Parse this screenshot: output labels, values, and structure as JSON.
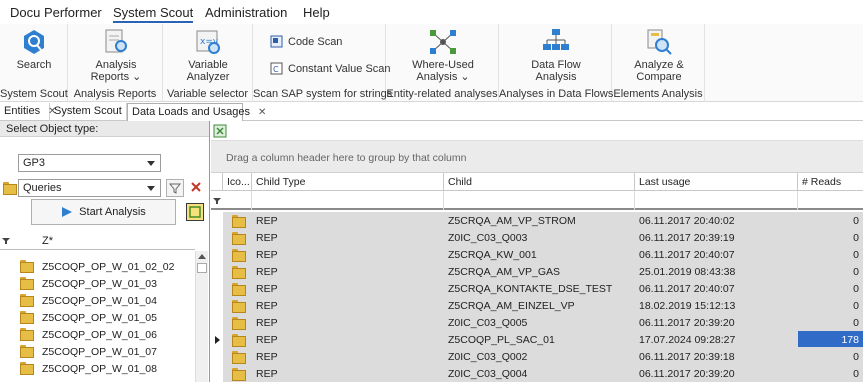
{
  "menu": {
    "items": [
      "Docu Performer",
      "System Scout",
      "Administration",
      "Help"
    ],
    "active": "System Scout"
  },
  "ribbon": {
    "search": "Search",
    "analysis_reports_l1": "Analysis",
    "analysis_reports_l2": "Reports ⌄",
    "variable_analyzer_l1": "Variable",
    "variable_analyzer_l2": "Analyzer",
    "code_scan": "Code Scan",
    "constant_value_scan": "Constant Value Scan",
    "where_used_l1": "Where-Used",
    "where_used_l2": "Analysis ⌄",
    "data_flow_l1": "Data Flow",
    "data_flow_l2": "Analysis",
    "analyze_compare_l1": "Analyze &",
    "analyze_compare_l2": "Compare",
    "groups": {
      "system_scout": "System Scout",
      "analysis_reports": "Analysis Reports",
      "variable_selector": "Variable selector",
      "scan_sap": "Scan SAP system for strings",
      "entity_related": "Entity-related analyses",
      "data_flows": "Analyses in Data Flows",
      "elements": "Elements Analysis"
    }
  },
  "tabs": [
    "Entities",
    "System Scout",
    "Data Loads and Usages"
  ],
  "left": {
    "header": "Select Object type:",
    "system_value": "GP3",
    "type_value": "Queries",
    "start_button": "Start Analysis",
    "filter_text": "Z*",
    "rows": [
      "Z5COQP_OP_W_01_02_02",
      "Z5COQP_OP_W_01_03",
      "Z5COQP_OP_W_01_04",
      "Z5COQP_OP_W_01_05",
      "Z5COQP_OP_W_01_06",
      "Z5COQP_OP_W_01_07",
      "Z5COQP_OP_W_01_08"
    ]
  },
  "grid": {
    "group_hint": "Drag a column header here to group by that column",
    "columns": [
      "Ico...",
      "Child Type",
      "Child",
      "Last usage",
      "# Reads"
    ],
    "rows": [
      {
        "type": "REP",
        "child": "Z5CRQA_AM_VP_STROM",
        "last_usage": "06.11.2017 20:40:02",
        "reads": "0"
      },
      {
        "type": "REP",
        "child": "Z0IC_C03_Q003",
        "last_usage": "06.11.2017 20:39:19",
        "reads": "0"
      },
      {
        "type": "REP",
        "child": "Z5CRQA_KW_001",
        "last_usage": "06.11.2017 20:40:07",
        "reads": "0"
      },
      {
        "type": "REP",
        "child": "Z5CRQA_AM_VP_GAS",
        "last_usage": "25.01.2019 08:43:38",
        "reads": "0"
      },
      {
        "type": "REP",
        "child": "Z5CRQA_KONTAKTE_DSE_TEST",
        "last_usage": "06.11.2017 20:40:07",
        "reads": "0"
      },
      {
        "type": "REP",
        "child": "Z5CRQA_AM_EINZEL_VP",
        "last_usage": "18.02.2019 15:12:13",
        "reads": "0"
      },
      {
        "type": "REP",
        "child": "Z0IC_C03_Q005",
        "last_usage": "06.11.2017 20:39:20",
        "reads": "0"
      },
      {
        "type": "REP",
        "child": "Z5COQP_PL_SAC_01",
        "last_usage": "17.07.2024 09:28:27",
        "reads": "178"
      },
      {
        "type": "REP",
        "child": "Z0IC_C03_Q002",
        "last_usage": "06.11.2017 20:39:18",
        "reads": "0"
      },
      {
        "type": "REP",
        "child": "Z0IC_C03_Q004",
        "last_usage": "06.11.2017 20:39:20",
        "reads": "0"
      }
    ],
    "current_row": 7
  }
}
